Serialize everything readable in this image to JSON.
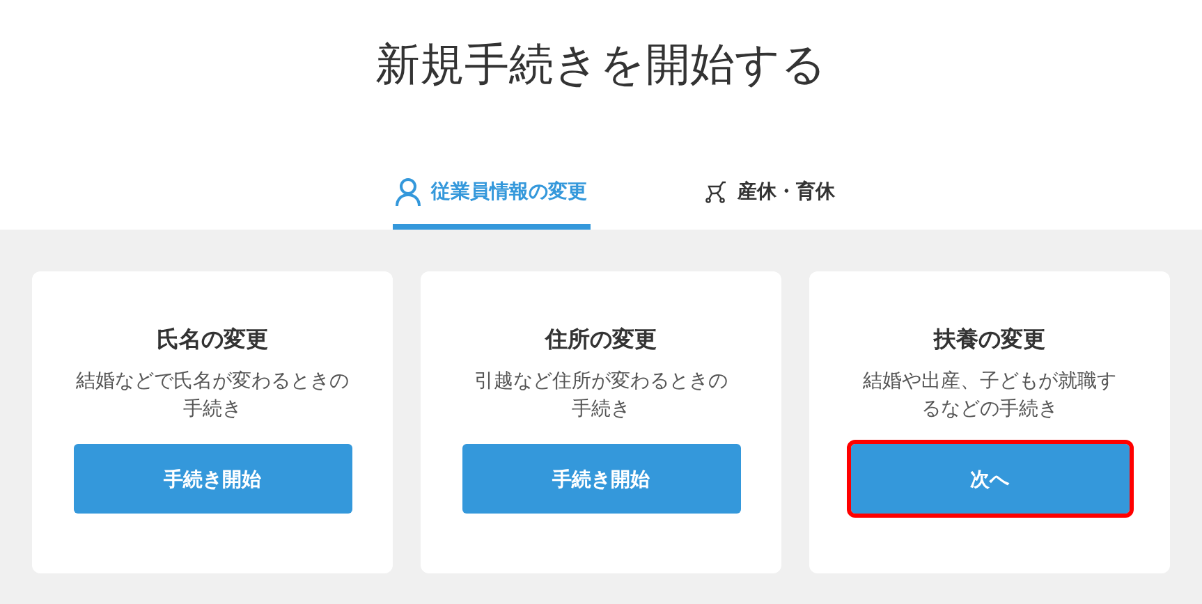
{
  "page_title": "新規手続きを開始する",
  "tabs": [
    {
      "label": "従業員情報の変更",
      "kind": "person",
      "selected": true
    },
    {
      "label": "産休・育休",
      "kind": "stroller",
      "selected": false
    }
  ],
  "cards": [
    {
      "title": "氏名の変更",
      "description_lines": [
        "結婚などで氏名が変わるときの",
        "手続き"
      ],
      "button": {
        "label": "手続き開始",
        "highlighted": false
      }
    },
    {
      "title": "住所の変更",
      "description_lines": [
        "引越など住所が変わるときの",
        "手続き"
      ],
      "button": {
        "label": "手続き開始",
        "highlighted": false
      }
    },
    {
      "title": "扶養の変更",
      "description_lines": [
        "結婚や出産、子どもが就職す",
        "るなどの手続き"
      ],
      "button": {
        "label": "次へ",
        "highlighted": true
      }
    }
  ]
}
